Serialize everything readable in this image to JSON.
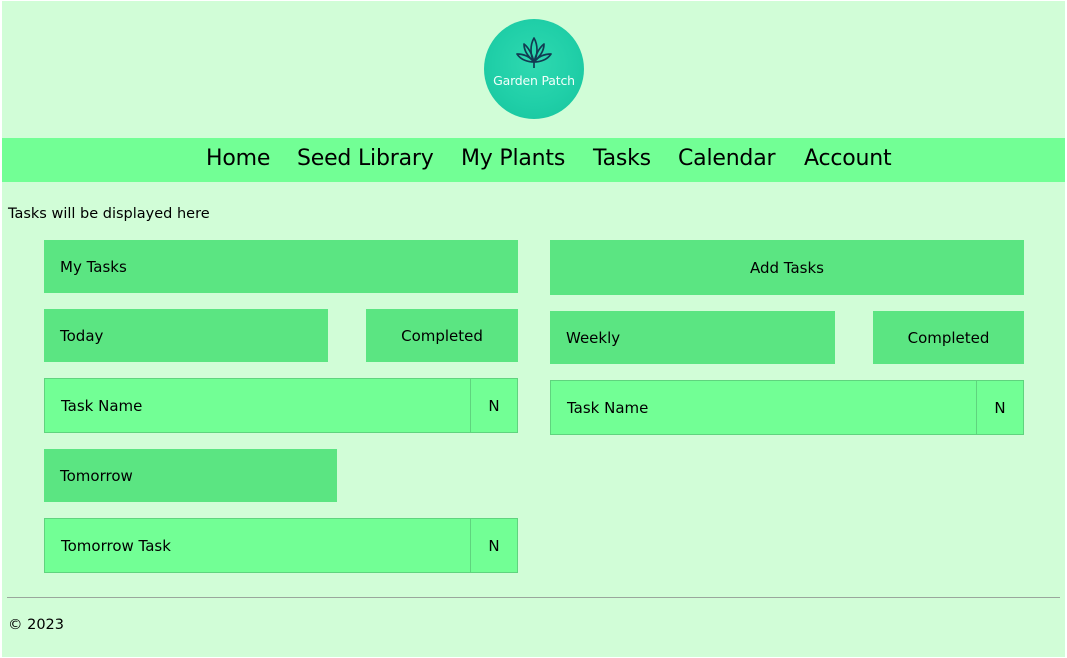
{
  "logo": {
    "text": "Garden Patch",
    "icon": "lotus-leaf-icon",
    "color": "#1fcfa6"
  },
  "nav": {
    "items": [
      {
        "label": "Home"
      },
      {
        "label": "Seed Library"
      },
      {
        "label": "My Plants"
      },
      {
        "label": "Tasks"
      },
      {
        "label": "Calendar"
      },
      {
        "label": "Account"
      }
    ]
  },
  "intro": "Tasks will be displayed here",
  "left": {
    "title": "My Tasks",
    "today": {
      "label": "Today",
      "completed_label": "Completed",
      "tasks": [
        {
          "name": "Task Name",
          "status": "N"
        }
      ]
    },
    "tomorrow": {
      "label": "Tomorrow",
      "tasks": [
        {
          "name": "Tomorrow Task",
          "status": "N"
        }
      ]
    }
  },
  "right": {
    "add_label": "Add Tasks",
    "weekly": {
      "label": "Weekly",
      "completed_label": "Completed",
      "tasks": [
        {
          "name": "Task Name",
          "status": "N"
        }
      ]
    }
  },
  "footer": {
    "copyright": "© 2023"
  },
  "colors": {
    "page_background": "#d1fdd7",
    "nav_background": "#72ff95",
    "panel": "#5be582",
    "task_row": "#72ff95"
  }
}
